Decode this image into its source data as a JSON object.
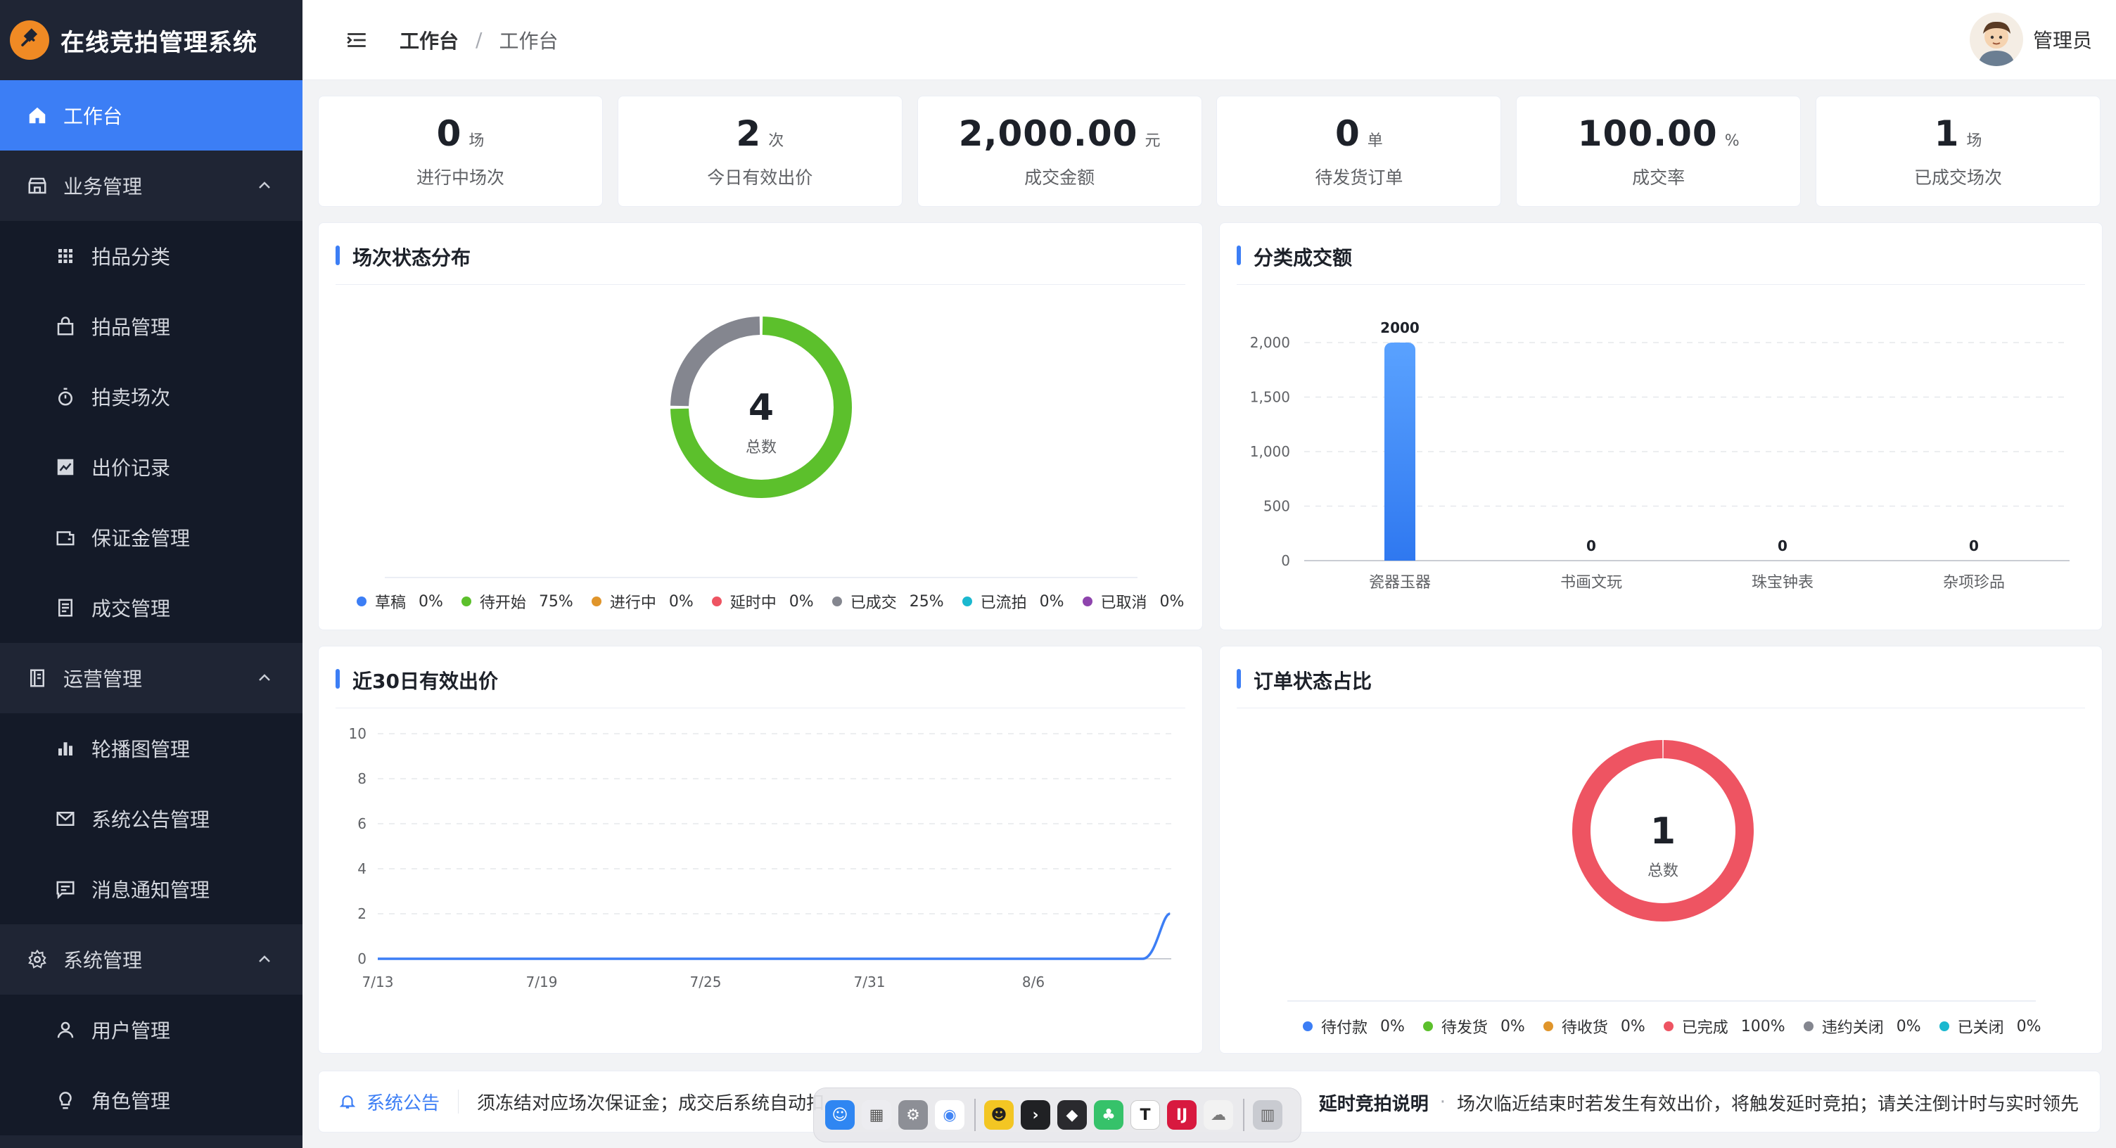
{
  "app": {
    "title": "在线竞拍管理系统"
  },
  "sidebar": {
    "items": [
      {
        "label": "工作台",
        "icon": "home-icon",
        "kind": "active"
      },
      {
        "label": "业务管理",
        "icon": "store-icon",
        "kind": "group"
      },
      {
        "label": "拍品分类",
        "icon": "grid-icon",
        "kind": "sub"
      },
      {
        "label": "拍品管理",
        "icon": "bag-icon",
        "kind": "sub"
      },
      {
        "label": "拍卖场次",
        "icon": "stopwatch-icon",
        "kind": "sub"
      },
      {
        "label": "出价记录",
        "icon": "trend-chart-icon",
        "kind": "sub"
      },
      {
        "label": "保证金管理",
        "icon": "wallet-icon",
        "kind": "sub"
      },
      {
        "label": "成交管理",
        "icon": "document-icon",
        "kind": "sub"
      },
      {
        "label": "运营管理",
        "icon": "notebook-icon",
        "kind": "group"
      },
      {
        "label": "轮播图管理",
        "icon": "bar-chart-icon",
        "kind": "sub"
      },
      {
        "label": "系统公告管理",
        "icon": "mail-icon",
        "kind": "sub"
      },
      {
        "label": "消息通知管理",
        "icon": "message-icon",
        "kind": "sub"
      },
      {
        "label": "系统管理",
        "icon": "gear-icon",
        "kind": "group"
      },
      {
        "label": "用户管理",
        "icon": "user-icon",
        "kind": "sub"
      },
      {
        "label": "角色管理",
        "icon": "bulb-icon",
        "kind": "sub"
      }
    ]
  },
  "header": {
    "breadcrumb": [
      "工作台",
      "工作台"
    ],
    "separator": "/",
    "user_name": "管理员"
  },
  "stats": [
    {
      "value": "0",
      "unit": "场",
      "label": "进行中场次"
    },
    {
      "value": "2",
      "unit": "次",
      "label": "今日有效出价"
    },
    {
      "value": "2,000.00",
      "unit": "元",
      "label": "成交金额"
    },
    {
      "value": "0",
      "unit": "单",
      "label": "待发货订单"
    },
    {
      "value": "100.00",
      "unit": "%",
      "label": "成交率"
    },
    {
      "value": "1",
      "unit": "场",
      "label": "已成交场次"
    }
  ],
  "cards": {
    "session_status": {
      "title": "场次状态分布"
    },
    "category_amount": {
      "title": "分类成交额"
    },
    "bids_30d": {
      "title": "近30日有效出价"
    },
    "order_status": {
      "title": "订单状态占比"
    }
  },
  "colors": {
    "blue": "#3c7ef5",
    "green": "#5cc02c",
    "orange": "#e0952b",
    "red": "#ee5462",
    "gray": "#84868f",
    "cyan": "#1bb8cf",
    "purple": "#8e44ad"
  },
  "chart_data": [
    {
      "type": "pie",
      "center_value": "4",
      "center_label": "总数",
      "slices": [
        {
          "name": "草稿",
          "pct": "0%",
          "value": 0,
          "color": "#3c7ef5"
        },
        {
          "name": "待开始",
          "pct": "75%",
          "value": 75,
          "color": "#5cc02c"
        },
        {
          "name": "进行中",
          "pct": "0%",
          "value": 0,
          "color": "#e0952b"
        },
        {
          "name": "延时中",
          "pct": "0%",
          "value": 0,
          "color": "#ee5462"
        },
        {
          "name": "已成交",
          "pct": "25%",
          "value": 25,
          "color": "#84868f"
        },
        {
          "name": "已流拍",
          "pct": "0%",
          "value": 0,
          "color": "#1bb8cf"
        },
        {
          "name": "已取消",
          "pct": "0%",
          "value": 0,
          "color": "#8e44ad"
        }
      ]
    },
    {
      "type": "bar",
      "categories": [
        "瓷器玉器",
        "书画文玩",
        "珠宝钟表",
        "杂项珍品"
      ],
      "values": [
        2000,
        0,
        0,
        0
      ],
      "ylim": [
        0,
        2000
      ],
      "yticks": [
        0,
        500,
        1000,
        1500,
        2000
      ],
      "ytick_labels": [
        "0",
        "500",
        "1,000",
        "1,500",
        "2,000"
      ],
      "grid": true
    },
    {
      "type": "line",
      "x_tick_labels": [
        "7/13",
        "7/19",
        "7/25",
        "7/31",
        "8/6"
      ],
      "x": [
        "7/13",
        "7/14",
        "7/15",
        "7/16",
        "7/17",
        "7/18",
        "7/19",
        "7/20",
        "7/21",
        "7/22",
        "7/23",
        "7/24",
        "7/25",
        "7/26",
        "7/27",
        "7/28",
        "7/29",
        "7/30",
        "7/31",
        "8/1",
        "8/2",
        "8/3",
        "8/4",
        "8/5",
        "8/6",
        "8/7",
        "8/8",
        "8/9",
        "8/10",
        "8/11"
      ],
      "values": [
        0,
        0,
        0,
        0,
        0,
        0,
        0,
        0,
        0,
        0,
        0,
        0,
        0,
        0,
        0,
        0,
        0,
        0,
        0,
        0,
        0,
        0,
        0,
        0,
        0,
        0,
        0,
        0,
        0,
        2
      ],
      "ylim": [
        0,
        10
      ],
      "yticks": [
        0,
        2,
        4,
        6,
        8,
        10
      ],
      "grid": true
    },
    {
      "type": "pie",
      "center_value": "1",
      "center_label": "总数",
      "slices": [
        {
          "name": "待付款",
          "pct": "0%",
          "value": 0,
          "color": "#3c7ef5"
        },
        {
          "name": "待发货",
          "pct": "0%",
          "value": 0,
          "color": "#5cc02c"
        },
        {
          "name": "待收货",
          "pct": "0%",
          "value": 0,
          "color": "#e0952b"
        },
        {
          "name": "已完成",
          "pct": "100%",
          "value": 100,
          "color": "#ee5462"
        },
        {
          "name": "违约关闭",
          "pct": "0%",
          "value": 0,
          "color": "#84868f"
        },
        {
          "name": "已关闭",
          "pct": "0%",
          "value": 0,
          "color": "#1bb8cf"
        }
      ]
    }
  ],
  "notice": {
    "tag": "系统公告",
    "text": "须冻结对应场次保证金；成交后系统自动扣",
    "right_title": "延时竞拍说明",
    "right_dot": "·",
    "right_text": "场次临近结束时若发生有效出价，将触发延时竞拍；请关注倒计时与实时领先"
  }
}
